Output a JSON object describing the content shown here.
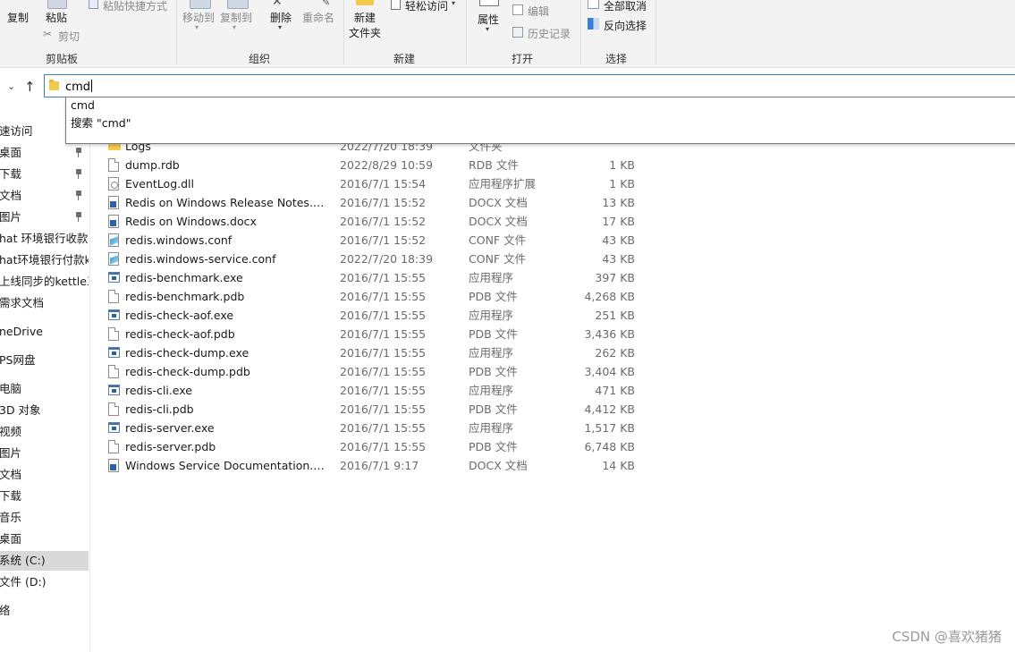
{
  "ribbon": {
    "clipboard": {
      "copy": "复制",
      "paste": "粘贴",
      "paste_shortcut": "粘贴快捷方式",
      "cut": "剪切",
      "label": "剪贴板"
    },
    "organize": {
      "move_to": "移动到",
      "copy_to": "复制到",
      "delete": "删除",
      "rename": "重命名",
      "label": "组织"
    },
    "new": {
      "new_folder_line1": "新建",
      "new_folder_line2": "文件夹",
      "easy_access": "轻松访问",
      "label": "新建"
    },
    "open": {
      "properties": "属性",
      "edit": "编辑",
      "history": "历史记录",
      "label": "打开"
    },
    "select": {
      "select_all": "全部取消",
      "invert": "反向选择",
      "label": "选择"
    }
  },
  "address": {
    "value": "cmd"
  },
  "autocomplete": {
    "items": [
      "cmd",
      "搜索 \"cmd\""
    ]
  },
  "nav": {
    "items": [
      {
        "label": "速访问",
        "pinned": false
      },
      {
        "label": "桌面",
        "pinned": true
      },
      {
        "label": "下载",
        "pinned": true
      },
      {
        "label": "文档",
        "pinned": true
      },
      {
        "label": "图片",
        "pinned": true
      },
      {
        "label": "hat 环境银行收款ktr",
        "pinned": false
      },
      {
        "label": "hat环境银行付款ktr",
        "pinned": false
      },
      {
        "label": "上线同步的kettle工",
        "pinned": false
      },
      {
        "label": "需求文档",
        "pinned": false
      },
      {
        "label": "neDrive",
        "pinned": false
      },
      {
        "label": "PS网盘",
        "pinned": false
      },
      {
        "label": "电脑",
        "pinned": false
      },
      {
        "label": "3D 对象",
        "pinned": false
      },
      {
        "label": "视频",
        "pinned": false
      },
      {
        "label": "图片",
        "pinned": false
      },
      {
        "label": "文档",
        "pinned": false
      },
      {
        "label": "下载",
        "pinned": false
      },
      {
        "label": "音乐",
        "pinned": false
      },
      {
        "label": "桌面",
        "pinned": false
      },
      {
        "label": "系统 (C:)",
        "pinned": false,
        "selected": true
      },
      {
        "label": "文件 (D:)",
        "pinned": false
      },
      {
        "label": "络",
        "pinned": false
      }
    ]
  },
  "files": [
    {
      "name": "Logs",
      "date": "2022/7/20 18:39",
      "type": "文件夹",
      "size": "",
      "icon": "folder-icon",
      "clipped": true
    },
    {
      "name": "dump.rdb",
      "date": "2022/8/29 10:59",
      "type": "RDB 文件",
      "size": "1 KB",
      "icon": "file-icon"
    },
    {
      "name": "EventLog.dll",
      "date": "2016/7/1 15:54",
      "type": "应用程序扩展",
      "size": "1 KB",
      "icon": "dll-icon"
    },
    {
      "name": "Redis on Windows Release Notes.docx",
      "date": "2016/7/1 15:52",
      "type": "DOCX 文档",
      "size": "13 KB",
      "icon": "word-doc-icon"
    },
    {
      "name": "Redis on Windows.docx",
      "date": "2016/7/1 15:52",
      "type": "DOCX 文档",
      "size": "17 KB",
      "icon": "word-doc-icon"
    },
    {
      "name": "redis.windows.conf",
      "date": "2016/7/1 15:52",
      "type": "CONF 文件",
      "size": "43 KB",
      "icon": "conf-file-icon"
    },
    {
      "name": "redis.windows-service.conf",
      "date": "2022/7/20 18:39",
      "type": "CONF 文件",
      "size": "43 KB",
      "icon": "conf-file-icon"
    },
    {
      "name": "redis-benchmark.exe",
      "date": "2016/7/1 15:55",
      "type": "应用程序",
      "size": "397 KB",
      "icon": "exe-icon"
    },
    {
      "name": "redis-benchmark.pdb",
      "date": "2016/7/1 15:55",
      "type": "PDB 文件",
      "size": "4,268 KB",
      "icon": "file-icon"
    },
    {
      "name": "redis-check-aof.exe",
      "date": "2016/7/1 15:55",
      "type": "应用程序",
      "size": "251 KB",
      "icon": "exe-icon"
    },
    {
      "name": "redis-check-aof.pdb",
      "date": "2016/7/1 15:55",
      "type": "PDB 文件",
      "size": "3,436 KB",
      "icon": "file-icon"
    },
    {
      "name": "redis-check-dump.exe",
      "date": "2016/7/1 15:55",
      "type": "应用程序",
      "size": "262 KB",
      "icon": "exe-icon"
    },
    {
      "name": "redis-check-dump.pdb",
      "date": "2016/7/1 15:55",
      "type": "PDB 文件",
      "size": "3,404 KB",
      "icon": "file-icon"
    },
    {
      "name": "redis-cli.exe",
      "date": "2016/7/1 15:55",
      "type": "应用程序",
      "size": "471 KB",
      "icon": "exe-icon"
    },
    {
      "name": "redis-cli.pdb",
      "date": "2016/7/1 15:55",
      "type": "PDB 文件",
      "size": "4,412 KB",
      "icon": "file-icon"
    },
    {
      "name": "redis-server.exe",
      "date": "2016/7/1 15:55",
      "type": "应用程序",
      "size": "1,517 KB",
      "icon": "exe-icon"
    },
    {
      "name": "redis-server.pdb",
      "date": "2016/7/1 15:55",
      "type": "PDB 文件",
      "size": "6,748 KB",
      "icon": "file-icon"
    },
    {
      "name": "Windows Service Documentation.docx",
      "date": "2016/7/1 9:17",
      "type": "DOCX 文档",
      "size": "14 KB",
      "icon": "word-doc-icon"
    }
  ],
  "watermark": "CSDN @喜欢猪猪"
}
